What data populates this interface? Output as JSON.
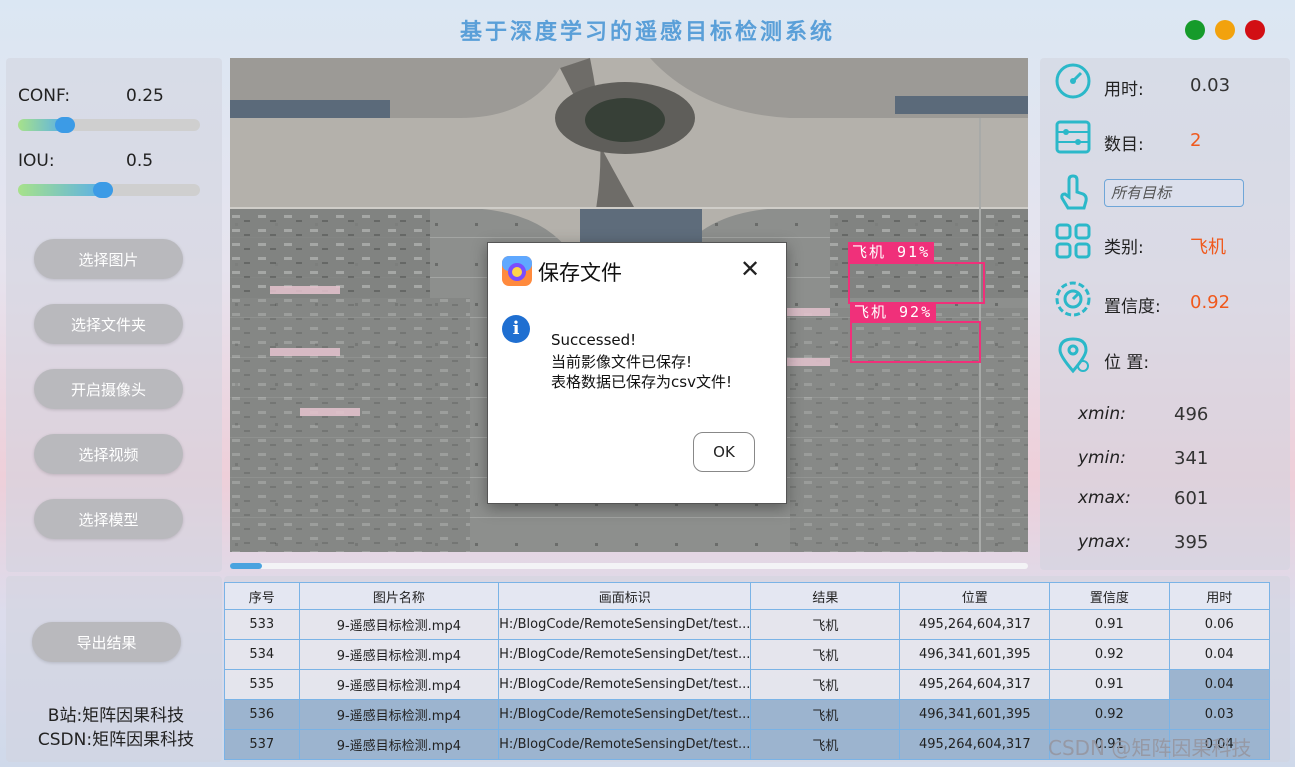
{
  "app": {
    "title": "基于深度学习的遥感目标检测系统"
  },
  "params": {
    "conf": {
      "label": "CONF:",
      "value": "0.25",
      "fraction": 0.25
    },
    "iou": {
      "label": "IOU:",
      "value": "0.5",
      "fraction": 0.5
    }
  },
  "buttons": {
    "select_image": "选择图片",
    "select_folder": "选择文件夹",
    "open_camera": "开启摄像头",
    "select_video": "选择视频",
    "select_model": "选择模型",
    "export": "导出结果"
  },
  "brand": {
    "line1": "B站:矩阵因果科技",
    "line2": "CSDN:矩阵因果科技"
  },
  "detections": [
    {
      "label": "飞机 91%"
    },
    {
      "label": "飞机 92%"
    }
  ],
  "video_progress": 0.04,
  "dialog": {
    "title": "保存文件",
    "close": "✕",
    "info_glyph": "i",
    "line1": "Successed!",
    "line2": "当前影像文件已保存!",
    "line3": "表格数据已保存为csv文件!",
    "ok": "OK"
  },
  "info": {
    "time_label": "用时:",
    "time_value": "0.03",
    "count_label": "数目:",
    "count_value": "2",
    "target_select": "所有目标",
    "class_label": "类别:",
    "class_value": "飞机",
    "conf_label": "置信度:",
    "conf_value": "0.92",
    "pos_label": "位 置:",
    "xmin_label": "xmin:",
    "xmin": "496",
    "ymin_label": "ymin:",
    "ymin": "341",
    "xmax_label": "xmax:",
    "xmax": "601",
    "ymax_label": "ymax:",
    "ymax": "395"
  },
  "table": {
    "headers": [
      "序号",
      "图片名称",
      "画面标识",
      "结果",
      "位置",
      "置信度",
      "用时"
    ],
    "rows": [
      [
        "533",
        "9-遥感目标检测.mp4",
        "H:/BlogCode/RemoteSensingDet/test...",
        "飞机",
        "495,264,604,317",
        "0.91",
        "0.06"
      ],
      [
        "534",
        "9-遥感目标检测.mp4",
        "H:/BlogCode/RemoteSensingDet/test...",
        "飞机",
        "496,341,601,395",
        "0.92",
        "0.04"
      ],
      [
        "535",
        "9-遥感目标检测.mp4",
        "H:/BlogCode/RemoteSensingDet/test...",
        "飞机",
        "495,264,604,317",
        "0.91",
        "0.04"
      ],
      [
        "536",
        "9-遥感目标检测.mp4",
        "H:/BlogCode/RemoteSensingDet/test...",
        "飞机",
        "496,341,601,395",
        "0.92",
        "0.03"
      ],
      [
        "537",
        "9-遥感目标检测.mp4",
        "H:/BlogCode/RemoteSensingDet/test...",
        "飞机",
        "495,264,604,317",
        "0.91",
        "0.04"
      ]
    ]
  },
  "watermark": "CSDN @矩阵因果科技",
  "colors": {
    "accent": "#3c9be6",
    "title": "#5a9fd8",
    "highlight": "#f0591d",
    "detect": "#f0307a"
  }
}
